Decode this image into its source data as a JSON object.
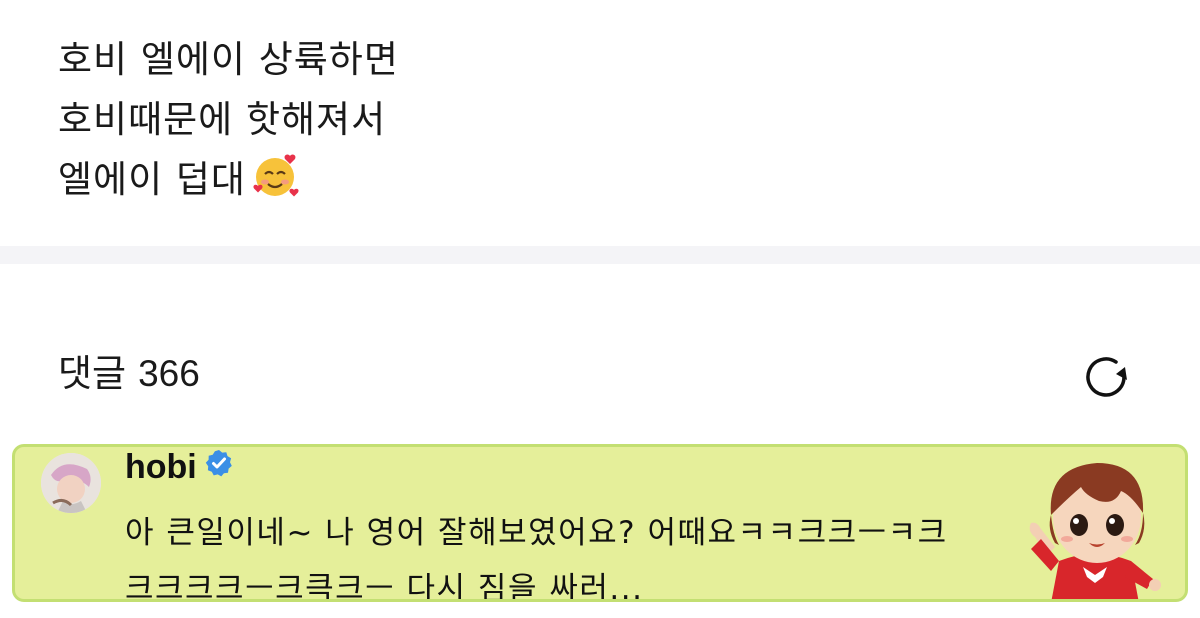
{
  "post": {
    "lines": [
      "호비 엘에이 상륙하면",
      "호비때문에 핫해져서",
      "엘에이 덥대"
    ],
    "trailing_emoji": "smiling-face-with-hearts-emoji"
  },
  "comments": {
    "label": "댓글",
    "count": "366",
    "refresh_icon": "refresh-icon"
  },
  "comment": {
    "author": "hobi",
    "verified_icon": "verified-badge-icon",
    "text_lines": [
      "아 큰일이네~ 나 영어 잘해보였어요? 어때요ㅋㅋ크크ㅡㅋ크",
      "크크크크ㅡ크큭크ㅡ 다시 짐을 싸러..."
    ],
    "highlight_color": "#e5ef9a",
    "border_color": "#c3df72",
    "sticker": "tinytan-character-sticker"
  },
  "colors": {
    "background": "#ffffff",
    "divider": "#f4f4f7",
    "verified_blue": "#3a8fe6"
  }
}
